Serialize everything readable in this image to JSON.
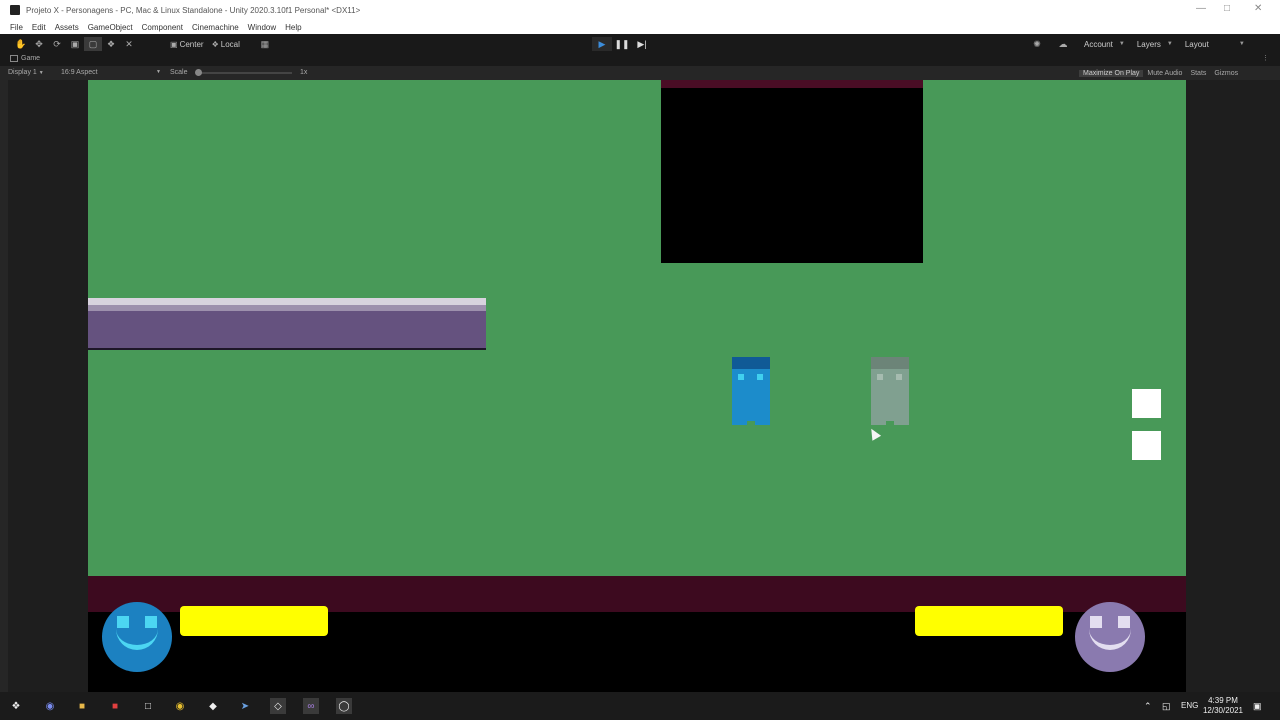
{
  "window": {
    "title": "Projeto X - Personagens - PC, Mac & Linux Standalone - Unity 2020.3.10f1 Personal* <DX11>"
  },
  "menu": [
    "File",
    "Edit",
    "Assets",
    "GameObject",
    "Component",
    "Cinemachine",
    "Window",
    "Help"
  ],
  "toolbar": {
    "pivot_center": "Center",
    "pivot_local": "Local",
    "account": "Account",
    "layers": "Layers",
    "layout": "Layout"
  },
  "game_view": {
    "tab_label": "Game",
    "display": "Display 1",
    "aspect": "16:9 Aspect",
    "scale_label": "Scale",
    "scale_value": "1x",
    "maximize_on_play": "Maximize On Play",
    "mute_audio": "Mute Audio",
    "stats": "Stats",
    "gizmos": "Gizmos"
  },
  "hud": {
    "player1_health": 1.0,
    "player2_health": 1.0
  },
  "taskbar": {
    "time": "4:39 PM",
    "date": "12/30/2021",
    "language": "ENG"
  },
  "colors": {
    "background_green": "#489958",
    "health_bar": "#ffff00",
    "player1": "#1c8ccb",
    "player2": "#8a7aaf",
    "floor": "#3d0a1f"
  }
}
